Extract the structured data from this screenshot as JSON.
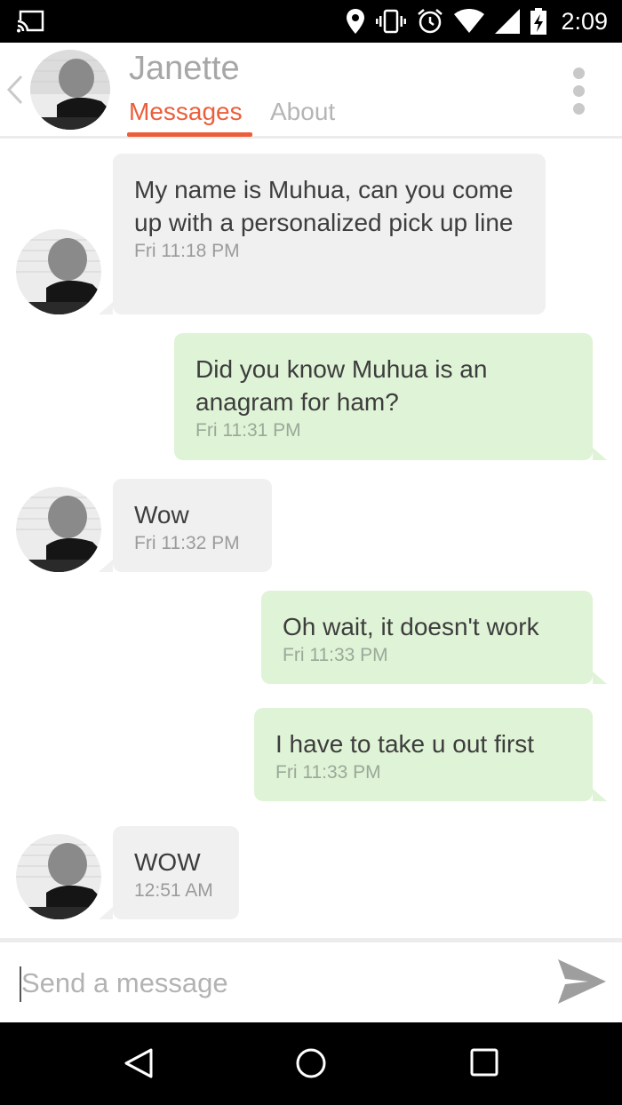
{
  "status_bar": {
    "time": "2:09",
    "icons": [
      "cast-icon",
      "location-icon",
      "vibrate-icon",
      "alarm-icon",
      "wifi-icon",
      "signal-icon",
      "battery-charging-icon"
    ]
  },
  "header": {
    "contact_name": "Janette",
    "tabs": [
      {
        "label": "Messages",
        "active": true
      },
      {
        "label": "About",
        "active": false
      }
    ],
    "accent_color": "#ec5e3b"
  },
  "messages": [
    {
      "direction": "incoming",
      "text": "My name is Muhua, can you come up with a personalized pick up line",
      "time": "Fri 11:18 PM"
    },
    {
      "direction": "outgoing",
      "text": "Did you know Muhua is an anagram for ham?",
      "time": "Fri 11:31 PM"
    },
    {
      "direction": "incoming",
      "text": "Wow",
      "time": "Fri 11:32 PM"
    },
    {
      "direction": "outgoing",
      "text": "Oh wait, it doesn't work",
      "time": "Fri 11:33 PM"
    },
    {
      "direction": "outgoing",
      "text": "I have to take u out first",
      "time": "Fri 11:33 PM"
    },
    {
      "direction": "incoming",
      "text": "WOW",
      "time": "12:51 AM"
    }
  ],
  "composer": {
    "placeholder": "Send a message",
    "value": ""
  },
  "nav_bar": {
    "icons": [
      "back-triangle-icon",
      "home-circle-icon",
      "recents-square-icon"
    ]
  }
}
